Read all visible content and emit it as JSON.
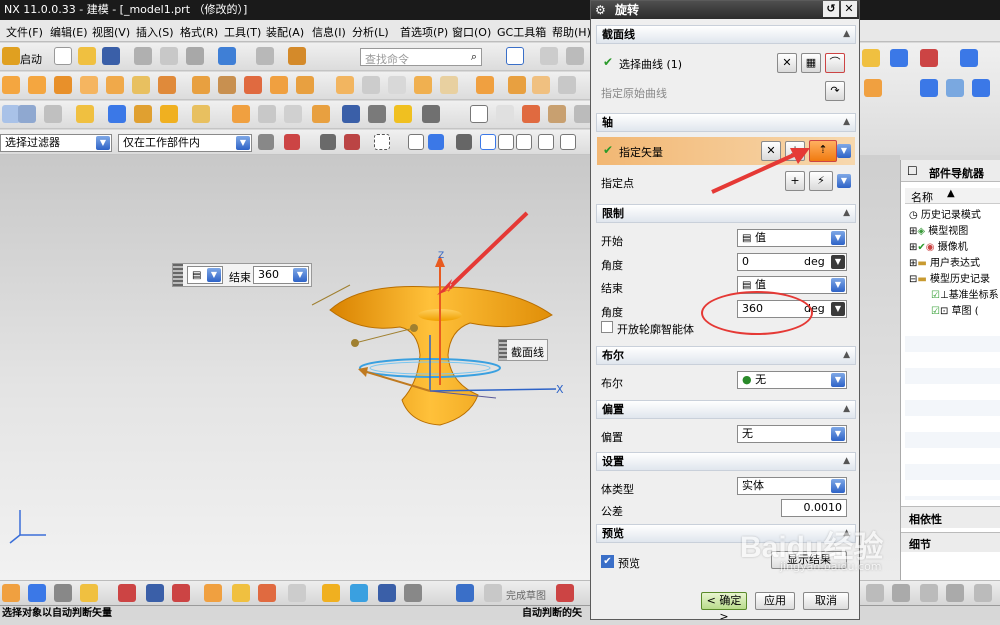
{
  "window_title": "NX 11.0.0.33 - 建模 - [_model1.prt （修改的）]",
  "menu": [
    "文件(F)",
    "编辑(E)",
    "视图(V)",
    "插入(S)",
    "格式(R)",
    "工具(T)",
    "装配(A)",
    "信息(I)",
    "分析(L)",
    "首选项(P)",
    "窗口(O)",
    "GC工具箱",
    "帮助(H)"
  ],
  "toolbar": {
    "start_label": "启动",
    "search_placeholder": "查找命令"
  },
  "filter": {
    "type_value": "选择过滤器",
    "scope_value": "仅在工作部件内"
  },
  "viewport": {
    "end_popup_label": "结束",
    "end_popup_value": "360",
    "section_tag": "截面线",
    "axis_x": "X",
    "axis_z": "Z"
  },
  "dialog": {
    "title": "旋转",
    "section_curve": {
      "header": "截面线",
      "select_curve": "选择曲线 (1)",
      "specify_origin": "指定原始曲线"
    },
    "axis": {
      "header": "轴",
      "specify_vector": "指定矢量",
      "specify_point": "指定点"
    },
    "limits": {
      "header": "限制",
      "start_label": "开始",
      "start_value": "值",
      "angle1_label": "角度",
      "angle1_value": "0",
      "angle1_unit": "deg",
      "end_label": "结束",
      "end_value": "值",
      "angle2_label": "角度",
      "angle2_value": "360",
      "angle2_unit": "deg",
      "open_profile": "开放轮廓智能体"
    },
    "boolean": {
      "header": "布尔",
      "label": "布尔",
      "value": "无"
    },
    "offset": {
      "header": "偏置",
      "label": "偏置",
      "value": "无"
    },
    "settings": {
      "header": "设置",
      "body_type_label": "体类型",
      "body_type_value": "实体",
      "tolerance_label": "公差",
      "tolerance_value": "0.0010"
    },
    "preview": {
      "header": "预览",
      "checkbox_label": "预览",
      "show_result": "显示结果"
    },
    "buttons": {
      "ok": "< 确定 >",
      "apply": "应用",
      "cancel": "取消"
    }
  },
  "navigator": {
    "title": "部件导航器",
    "col_name": "名称",
    "items": [
      "历史记录模式",
      "模型视图",
      "摄像机",
      "用户表达式",
      "模型历史记录",
      "基准坐标系",
      "草图 ("
    ],
    "dependency": "相依性",
    "details": "细节"
  },
  "bottombar": {
    "finish_sketch": "完成草图"
  },
  "status": {
    "left": "选择对象以自动判断矢量",
    "right": "自动判断的矢"
  },
  "watermark": {
    "brand": "Baidu经验",
    "url": "jingyan.baidu.com"
  },
  "colors": {
    "accent_orange": "#f5a623",
    "highlight_row": "#f2b773",
    "selection_blue": "#3b78e7",
    "arrow_red": "#e53935"
  }
}
